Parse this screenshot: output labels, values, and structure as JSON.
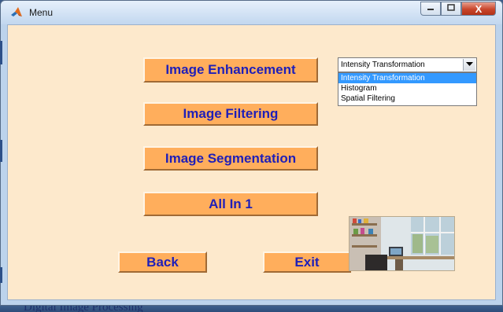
{
  "window": {
    "title": "Menu",
    "controls": {
      "minimize": "–",
      "maximize": "□",
      "close": "X"
    }
  },
  "buttons": {
    "image_enhancement": "Image Enhancement",
    "image_filtering": "Image Filtering",
    "image_segmentation": "Image Segmentation",
    "all_in_one": "All In 1",
    "back": "Back",
    "exit": "Exit"
  },
  "dropdown": {
    "selected": "Intensity Transformation",
    "options": [
      "Intensity Transformation",
      "Histogram",
      "Spatial Filtering"
    ],
    "highlighted_index": 0
  },
  "photo": {
    "description_icon": "room-photo-icon"
  },
  "background_text": "Digital Image Processing",
  "colors": {
    "client_bg": "#fde9cc",
    "button_bg": "#ffae5c",
    "button_text": "#1f1fb8",
    "highlight": "#3399ff"
  }
}
